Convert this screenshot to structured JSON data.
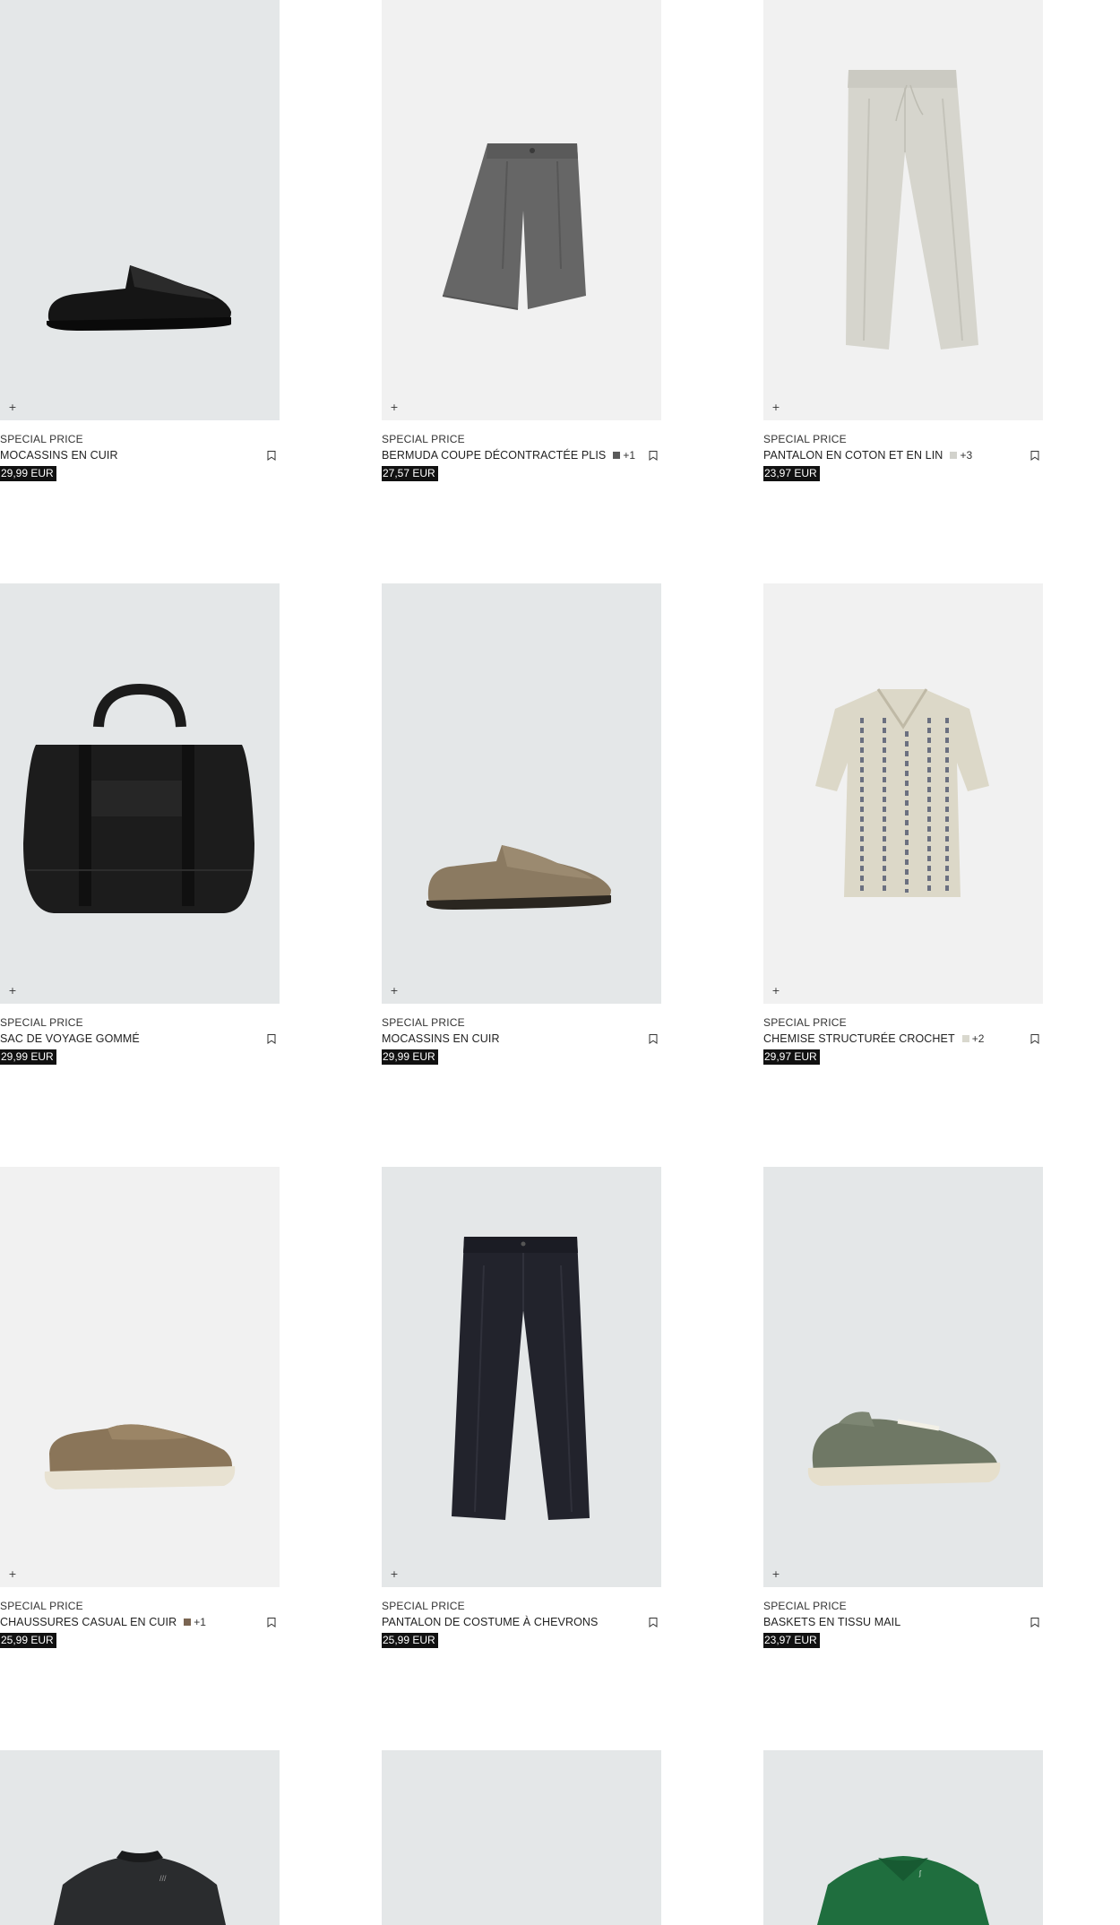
{
  "products": [
    {
      "tag": "SPECIAL PRICE",
      "name": "MOCASSINS EN CUIR",
      "price": "29,99 EUR",
      "swatch": "",
      "more": "",
      "bg": "#e4e7e8",
      "image": "black-loafer"
    },
    {
      "tag": "SPECIAL PRICE",
      "name": "BERMUDA COUPE DÉCONTRACTÉE PLIS",
      "price": "27,57 EUR",
      "swatch": "#5a5a5a",
      "more": "+1",
      "bg": "#f1f1f1",
      "image": "grey-shorts"
    },
    {
      "tag": "SPECIAL PRICE",
      "name": "PANTALON EN COTON ET EN LIN",
      "price": "23,97 EUR",
      "swatch": "#d2d2cc",
      "more": "+3",
      "bg": "#f1f1f1",
      "image": "linen-trousers"
    },
    {
      "tag": "SPECIAL PRICE",
      "name": "SAC DE VOYAGE GOMMÉ",
      "price": "29,99 EUR",
      "swatch": "",
      "more": "",
      "bg": "#e4e7e8",
      "image": "black-duffel-bag"
    },
    {
      "tag": "SPECIAL PRICE",
      "name": "MOCASSINS EN CUIR",
      "price": "29,99 EUR",
      "swatch": "",
      "more": "",
      "bg": "#e4e7e8",
      "image": "suede-loafer"
    },
    {
      "tag": "SPECIAL PRICE",
      "name": "CHEMISE STRUCTURÉE CROCHET",
      "price": "29,97 EUR",
      "swatch": "#d9d8ce",
      "more": "+2",
      "bg": "#f1f1f1",
      "image": "crochet-shirt"
    },
    {
      "tag": "SPECIAL PRICE",
      "name": "CHAUSSURES CASUAL EN CUIR",
      "price": "25,99 EUR",
      "swatch": "#7a6552",
      "more": "+1",
      "bg": "#f1f1f1",
      "image": "casual-shoe"
    },
    {
      "tag": "SPECIAL PRICE",
      "name": "PANTALON DE COSTUME À CHEVRONS",
      "price": "25,99 EUR",
      "swatch": "",
      "more": "",
      "bg": "#e4e7e8",
      "image": "navy-suit-trousers"
    },
    {
      "tag": "SPECIAL PRICE",
      "name": "BASKETS EN TISSU MAIL",
      "price": "23,97 EUR",
      "swatch": "",
      "more": "",
      "bg": "#e4e7e8",
      "image": "mesh-sneaker"
    },
    {
      "bg": "#e4e7e8",
      "image": "black-bomber-jacket"
    },
    {
      "bg": "#e4e7e8",
      "image": "blank"
    },
    {
      "bg": "#e4e7e8",
      "image": "green-polo"
    }
  ],
  "icons": {
    "add": "plus-icon",
    "wishlist": "bookmark-icon"
  }
}
